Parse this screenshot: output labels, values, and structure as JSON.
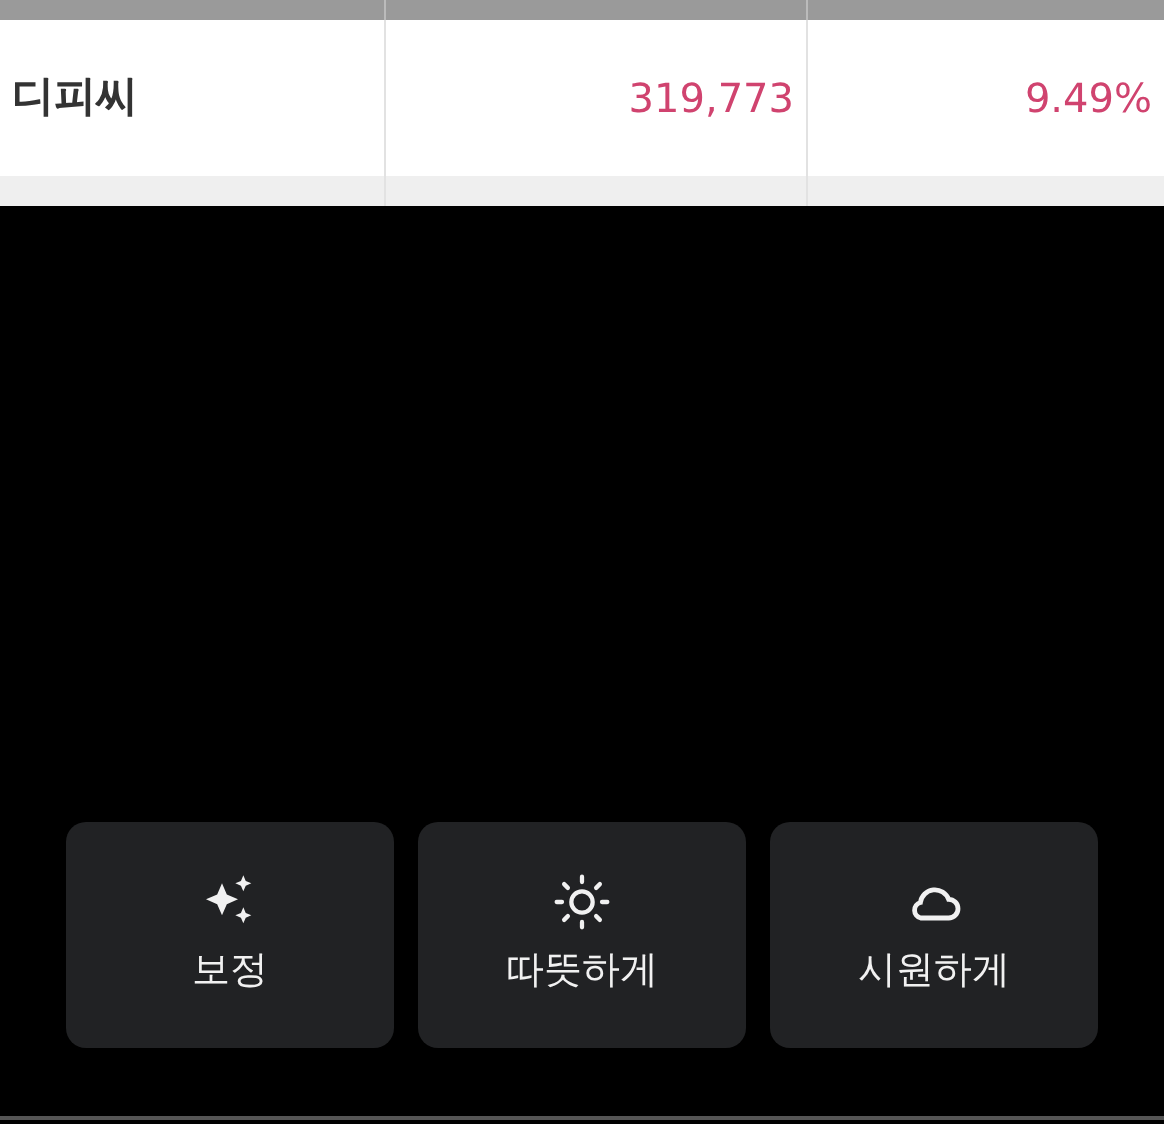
{
  "table": {
    "row": {
      "name": "디피씨",
      "value": "319,773",
      "percent": "9.49%"
    }
  },
  "actions": [
    {
      "kind": "enhance",
      "label": "보정"
    },
    {
      "kind": "warm",
      "label": "따뜻하게"
    },
    {
      "kind": "cool",
      "label": "시원하게"
    }
  ]
}
